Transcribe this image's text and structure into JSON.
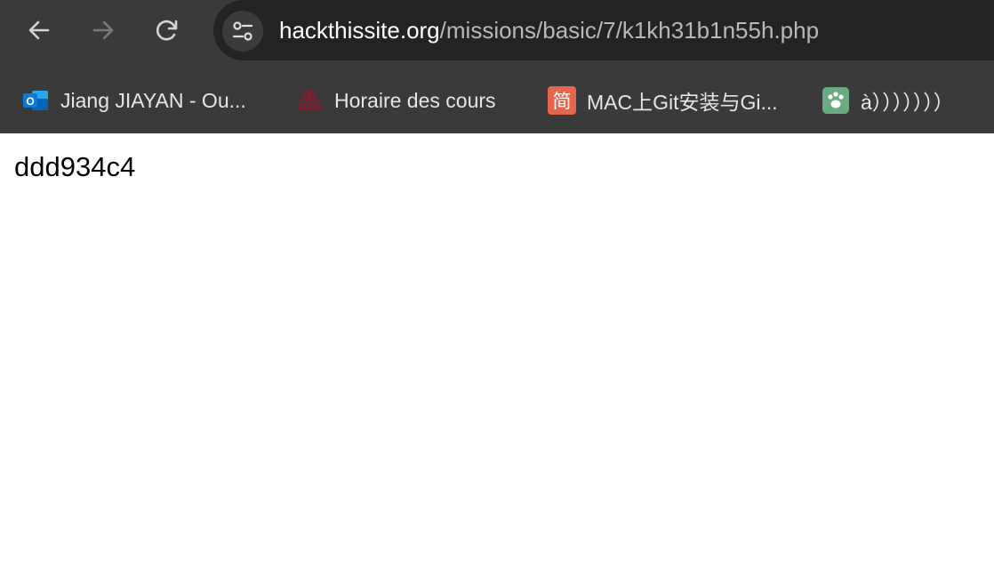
{
  "toolbar": {
    "back_icon": "arrow-left-icon",
    "forward_icon": "arrow-right-icon",
    "reload_icon": "reload-icon",
    "site_info_icon": "tune-icon"
  },
  "address_bar": {
    "host": "hackthissite.org",
    "path": "/missions/basic/7/k1kh31b1n55h.php"
  },
  "bookmarks": [
    {
      "label": "Jiang JIAYAN - Ou...",
      "icon": "outlook-icon",
      "icon_color": "#0f78d4"
    },
    {
      "label": "Horaire des cours",
      "icon": "school-logo-icon",
      "icon_color": "#8a1a2c"
    },
    {
      "label": "MAC上Git安装与Gi...",
      "icon": "jianshu-icon",
      "icon_color": "#e4664f",
      "icon_text": "简"
    },
    {
      "label": "à）））））））",
      "icon": "paw-icon",
      "icon_color": "#6aab83"
    }
  ],
  "page": {
    "content": "ddd934c4"
  },
  "colors": {
    "chrome_bg": "#3a3a3b",
    "omnibox_bg": "#232324",
    "page_bg": "#ffffff"
  }
}
